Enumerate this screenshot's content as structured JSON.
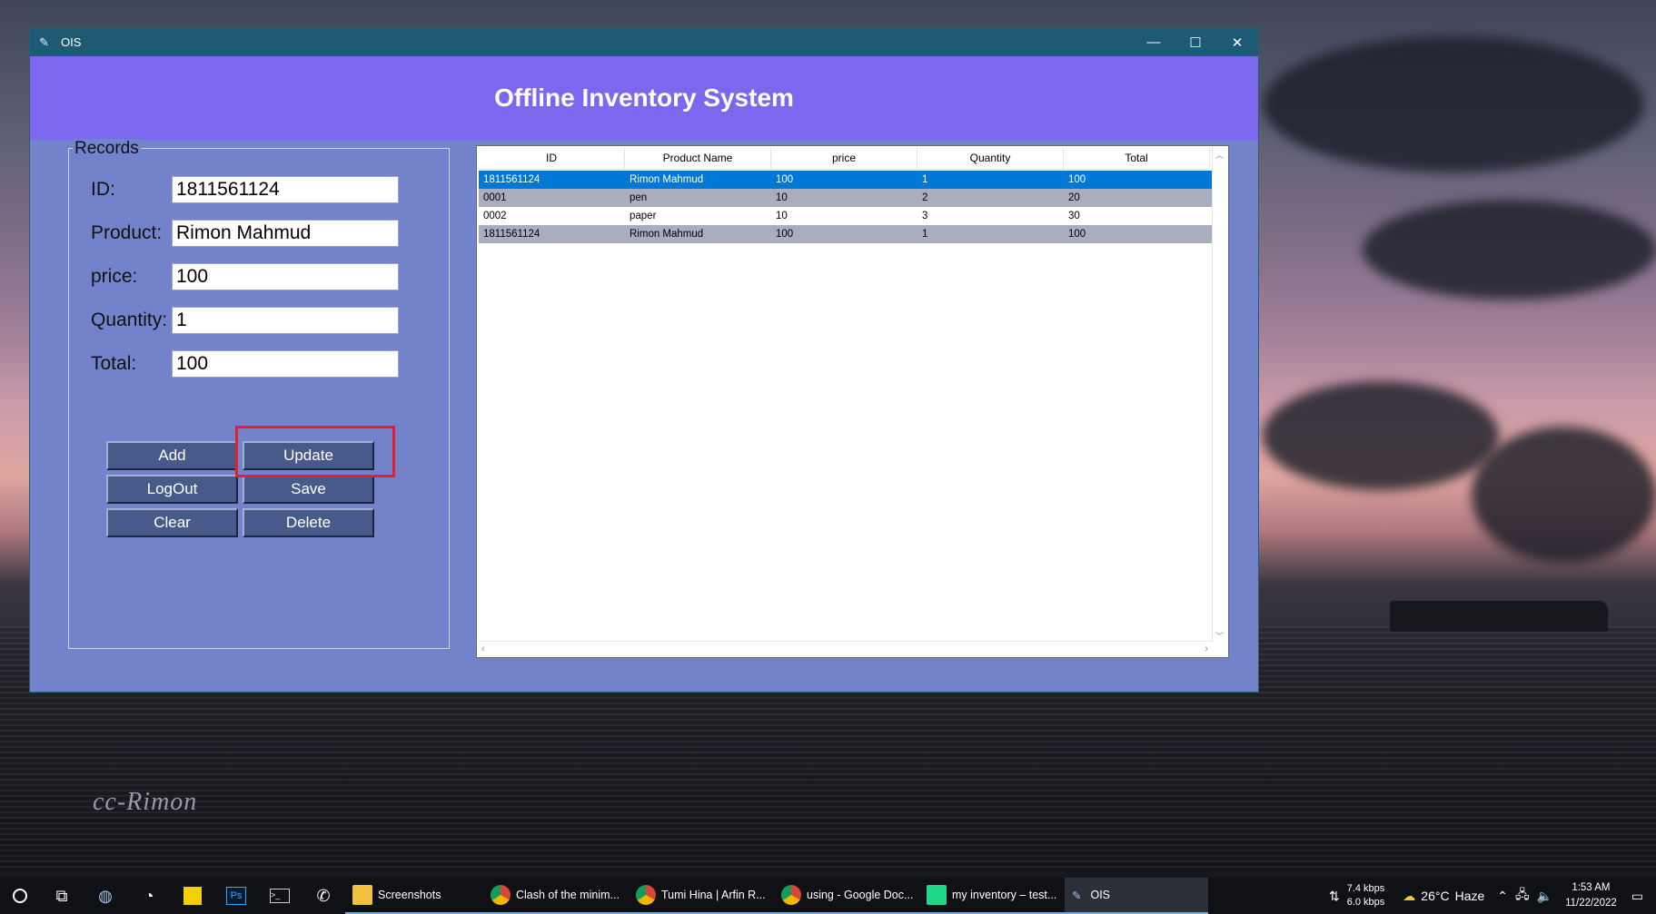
{
  "window": {
    "title": "OIS",
    "banner_title": "Offline Inventory System"
  },
  "form": {
    "legend": "Records",
    "fields": [
      {
        "label": "ID:",
        "value": "1811561124"
      },
      {
        "label": "Product:",
        "value": "Rimon Mahmud"
      },
      {
        "label": "price:",
        "value": "100"
      },
      {
        "label": "Quantity:",
        "value": "1"
      },
      {
        "label": "Total:",
        "value": "100"
      }
    ]
  },
  "buttons": {
    "add": "Add",
    "update": "Update",
    "logout": "LogOut",
    "save": "Save",
    "clear": "Clear",
    "delete": "Delete"
  },
  "table": {
    "columns": [
      "ID",
      "Product Name",
      "price",
      "Quantity",
      "Total"
    ],
    "rows": [
      [
        "1811561124",
        "Rimon Mahmud",
        "100",
        "1",
        "100"
      ],
      [
        "0001",
        "pen",
        "10",
        "2",
        "20"
      ],
      [
        "0002",
        "paper",
        "10",
        "3",
        "30"
      ],
      [
        "1811561124",
        "Rimon Mahmud",
        "100",
        "1",
        "100"
      ]
    ],
    "selected_row": 0
  },
  "desktop": {
    "watermark": "cc-Rimon"
  },
  "taskbar": {
    "apps": [
      "Screenshots",
      "Clash of the minim...",
      "Tumi Hina | Arfin R...",
      "using - Google Doc...",
      "my inventory – test...",
      "OIS"
    ],
    "net_down": "7.4 kbps",
    "net_up": "6.0 kbps",
    "weather_temp": "26°C",
    "weather_desc": "Haze",
    "time": "1:53 AM",
    "date": "11/22/2022"
  },
  "colors": {
    "banner": "#7b68ee",
    "window_bg": "#7283cb",
    "titlebar": "#1e5a73",
    "button": "#485a8a",
    "selection": "#0078d7",
    "highlight_box": "#e4202d"
  }
}
